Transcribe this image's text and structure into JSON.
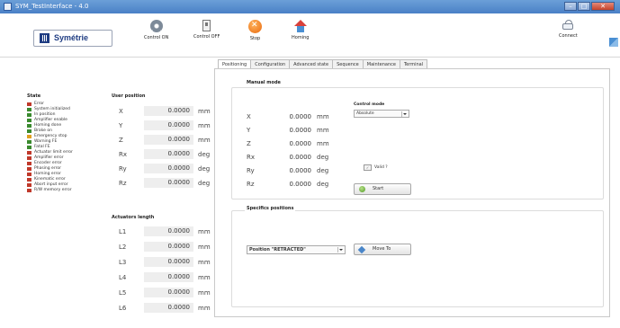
{
  "window": {
    "title": "SYM_TestInterface - 4.0"
  },
  "toolbar": {
    "logo_text": "Symétrie",
    "buttons": [
      {
        "label": "Control ON",
        "icon": "gear-icon"
      },
      {
        "label": "Control OFF",
        "icon": "switch-icon"
      },
      {
        "label": "Stop",
        "icon": "stop-icon"
      },
      {
        "label": "Homing",
        "icon": "home-icon"
      },
      {
        "label": "Connect",
        "icon": "connect-icon"
      }
    ]
  },
  "state": {
    "title": "State",
    "items": [
      {
        "label": "Error",
        "color": "#c0392b"
      },
      {
        "label": "System initialized",
        "color": "#3a8a2e"
      },
      {
        "label": "In position",
        "color": "#3a8a2e"
      },
      {
        "label": "Amplifier enable",
        "color": "#3a8a2e"
      },
      {
        "label": "Homing done",
        "color": "#3a8a2e"
      },
      {
        "label": "Brake on",
        "color": "#3a8a2e"
      },
      {
        "label": "Emergency stop",
        "color": "#e0a020"
      },
      {
        "label": "Warning FE",
        "color": "#3a8a2e"
      },
      {
        "label": "Fatal FE",
        "color": "#3a8a2e"
      },
      {
        "label": "Actuator limit error",
        "color": "#c0392b"
      },
      {
        "label": "Amplifier error",
        "color": "#c0392b"
      },
      {
        "label": "Encoder error",
        "color": "#c0392b"
      },
      {
        "label": "Phasing error",
        "color": "#c0392b"
      },
      {
        "label": "Homing error",
        "color": "#c0392b"
      },
      {
        "label": "Kinematic error",
        "color": "#c0392b"
      },
      {
        "label": "Abort input error",
        "color": "#c0392b"
      },
      {
        "label": "R/W memory error",
        "color": "#c0392b"
      }
    ]
  },
  "user_position": {
    "title": "User position",
    "rows": [
      {
        "axis": "X",
        "value": "0.0000",
        "unit": "mm"
      },
      {
        "axis": "Y",
        "value": "0.0000",
        "unit": "mm"
      },
      {
        "axis": "Z",
        "value": "0.0000",
        "unit": "mm"
      },
      {
        "axis": "Rx",
        "value": "0.0000",
        "unit": "deg"
      },
      {
        "axis": "Ry",
        "value": "0.0000",
        "unit": "deg"
      },
      {
        "axis": "Rz",
        "value": "0.0000",
        "unit": "deg"
      }
    ]
  },
  "actuators_length": {
    "title": "Actuators length",
    "rows": [
      {
        "axis": "L1",
        "value": "0.0000",
        "unit": "mm"
      },
      {
        "axis": "L2",
        "value": "0.0000",
        "unit": "mm"
      },
      {
        "axis": "L3",
        "value": "0.0000",
        "unit": "mm"
      },
      {
        "axis": "L4",
        "value": "0.0000",
        "unit": "mm"
      },
      {
        "axis": "L5",
        "value": "0.0000",
        "unit": "mm"
      },
      {
        "axis": "L6",
        "value": "0.0000",
        "unit": "mm"
      }
    ]
  },
  "tabs": [
    {
      "label": "Positioning",
      "active": true
    },
    {
      "label": "Configuration",
      "active": false
    },
    {
      "label": "Advanced state",
      "active": false
    },
    {
      "label": "Sequence",
      "active": false
    },
    {
      "label": "Maintenance",
      "active": false
    },
    {
      "label": "Terminal",
      "active": false
    }
  ],
  "manual_mode": {
    "title": "Manual mode",
    "rows": [
      {
        "axis": "X",
        "value": "0.0000",
        "unit": "mm"
      },
      {
        "axis": "Y",
        "value": "0.0000",
        "unit": "mm"
      },
      {
        "axis": "Z",
        "value": "0.0000",
        "unit": "mm"
      },
      {
        "axis": "Rx",
        "value": "0.0000",
        "unit": "deg"
      },
      {
        "axis": "Ry",
        "value": "0.0000",
        "unit": "deg"
      },
      {
        "axis": "Rz",
        "value": "0.0000",
        "unit": "deg"
      }
    ],
    "control_mode_label": "Control mode",
    "control_mode_value": "Absolute",
    "valid_label": "Valid ?",
    "start_label": "Start"
  },
  "specifics_positions": {
    "title": "Specifics positions",
    "selected": "Position \"RETRACTED\"",
    "move_to_label": "Move To"
  }
}
